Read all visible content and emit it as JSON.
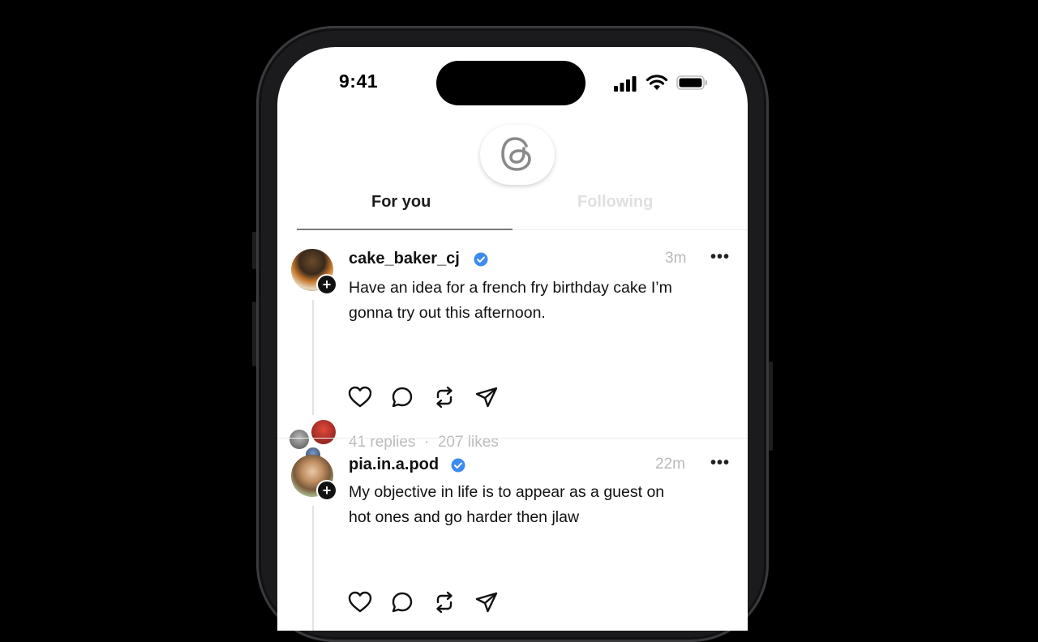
{
  "status_bar": {
    "time": "9:41",
    "icons": [
      "cellular-signal-icon",
      "wifi-icon",
      "battery-icon"
    ]
  },
  "header": {
    "logo": "threads-logo-icon",
    "tabs": [
      {
        "label": "For you",
        "active": true
      },
      {
        "label": "Following",
        "active": false
      }
    ]
  },
  "feed": {
    "posts": [
      {
        "username": "cake_baker_cj",
        "verified": true,
        "time": "3m",
        "more": "•••",
        "text_line1": "Have an idea for a french fry birthday cake I’m",
        "text_line2": "gonna try out this afternoon.",
        "stats": "41 replies  ·  207 likes",
        "actions": [
          "heart-icon",
          "comment-icon",
          "repost-icon",
          "share-icon"
        ]
      },
      {
        "username": "pia.in.a.pod",
        "verified": true,
        "time": "22m",
        "more": "•••",
        "text_line1": "My objective in life is to appear as a guest on",
        "text_line2": "hot ones and go harder then jlaw",
        "actions": [
          "heart-icon",
          "comment-icon",
          "repost-icon",
          "share-icon"
        ]
      }
    ]
  },
  "colors": {
    "background": "#000000",
    "screen": "#ffffff",
    "verified_badge": "#3d8bef",
    "muted_text": "#bcbcbc"
  }
}
